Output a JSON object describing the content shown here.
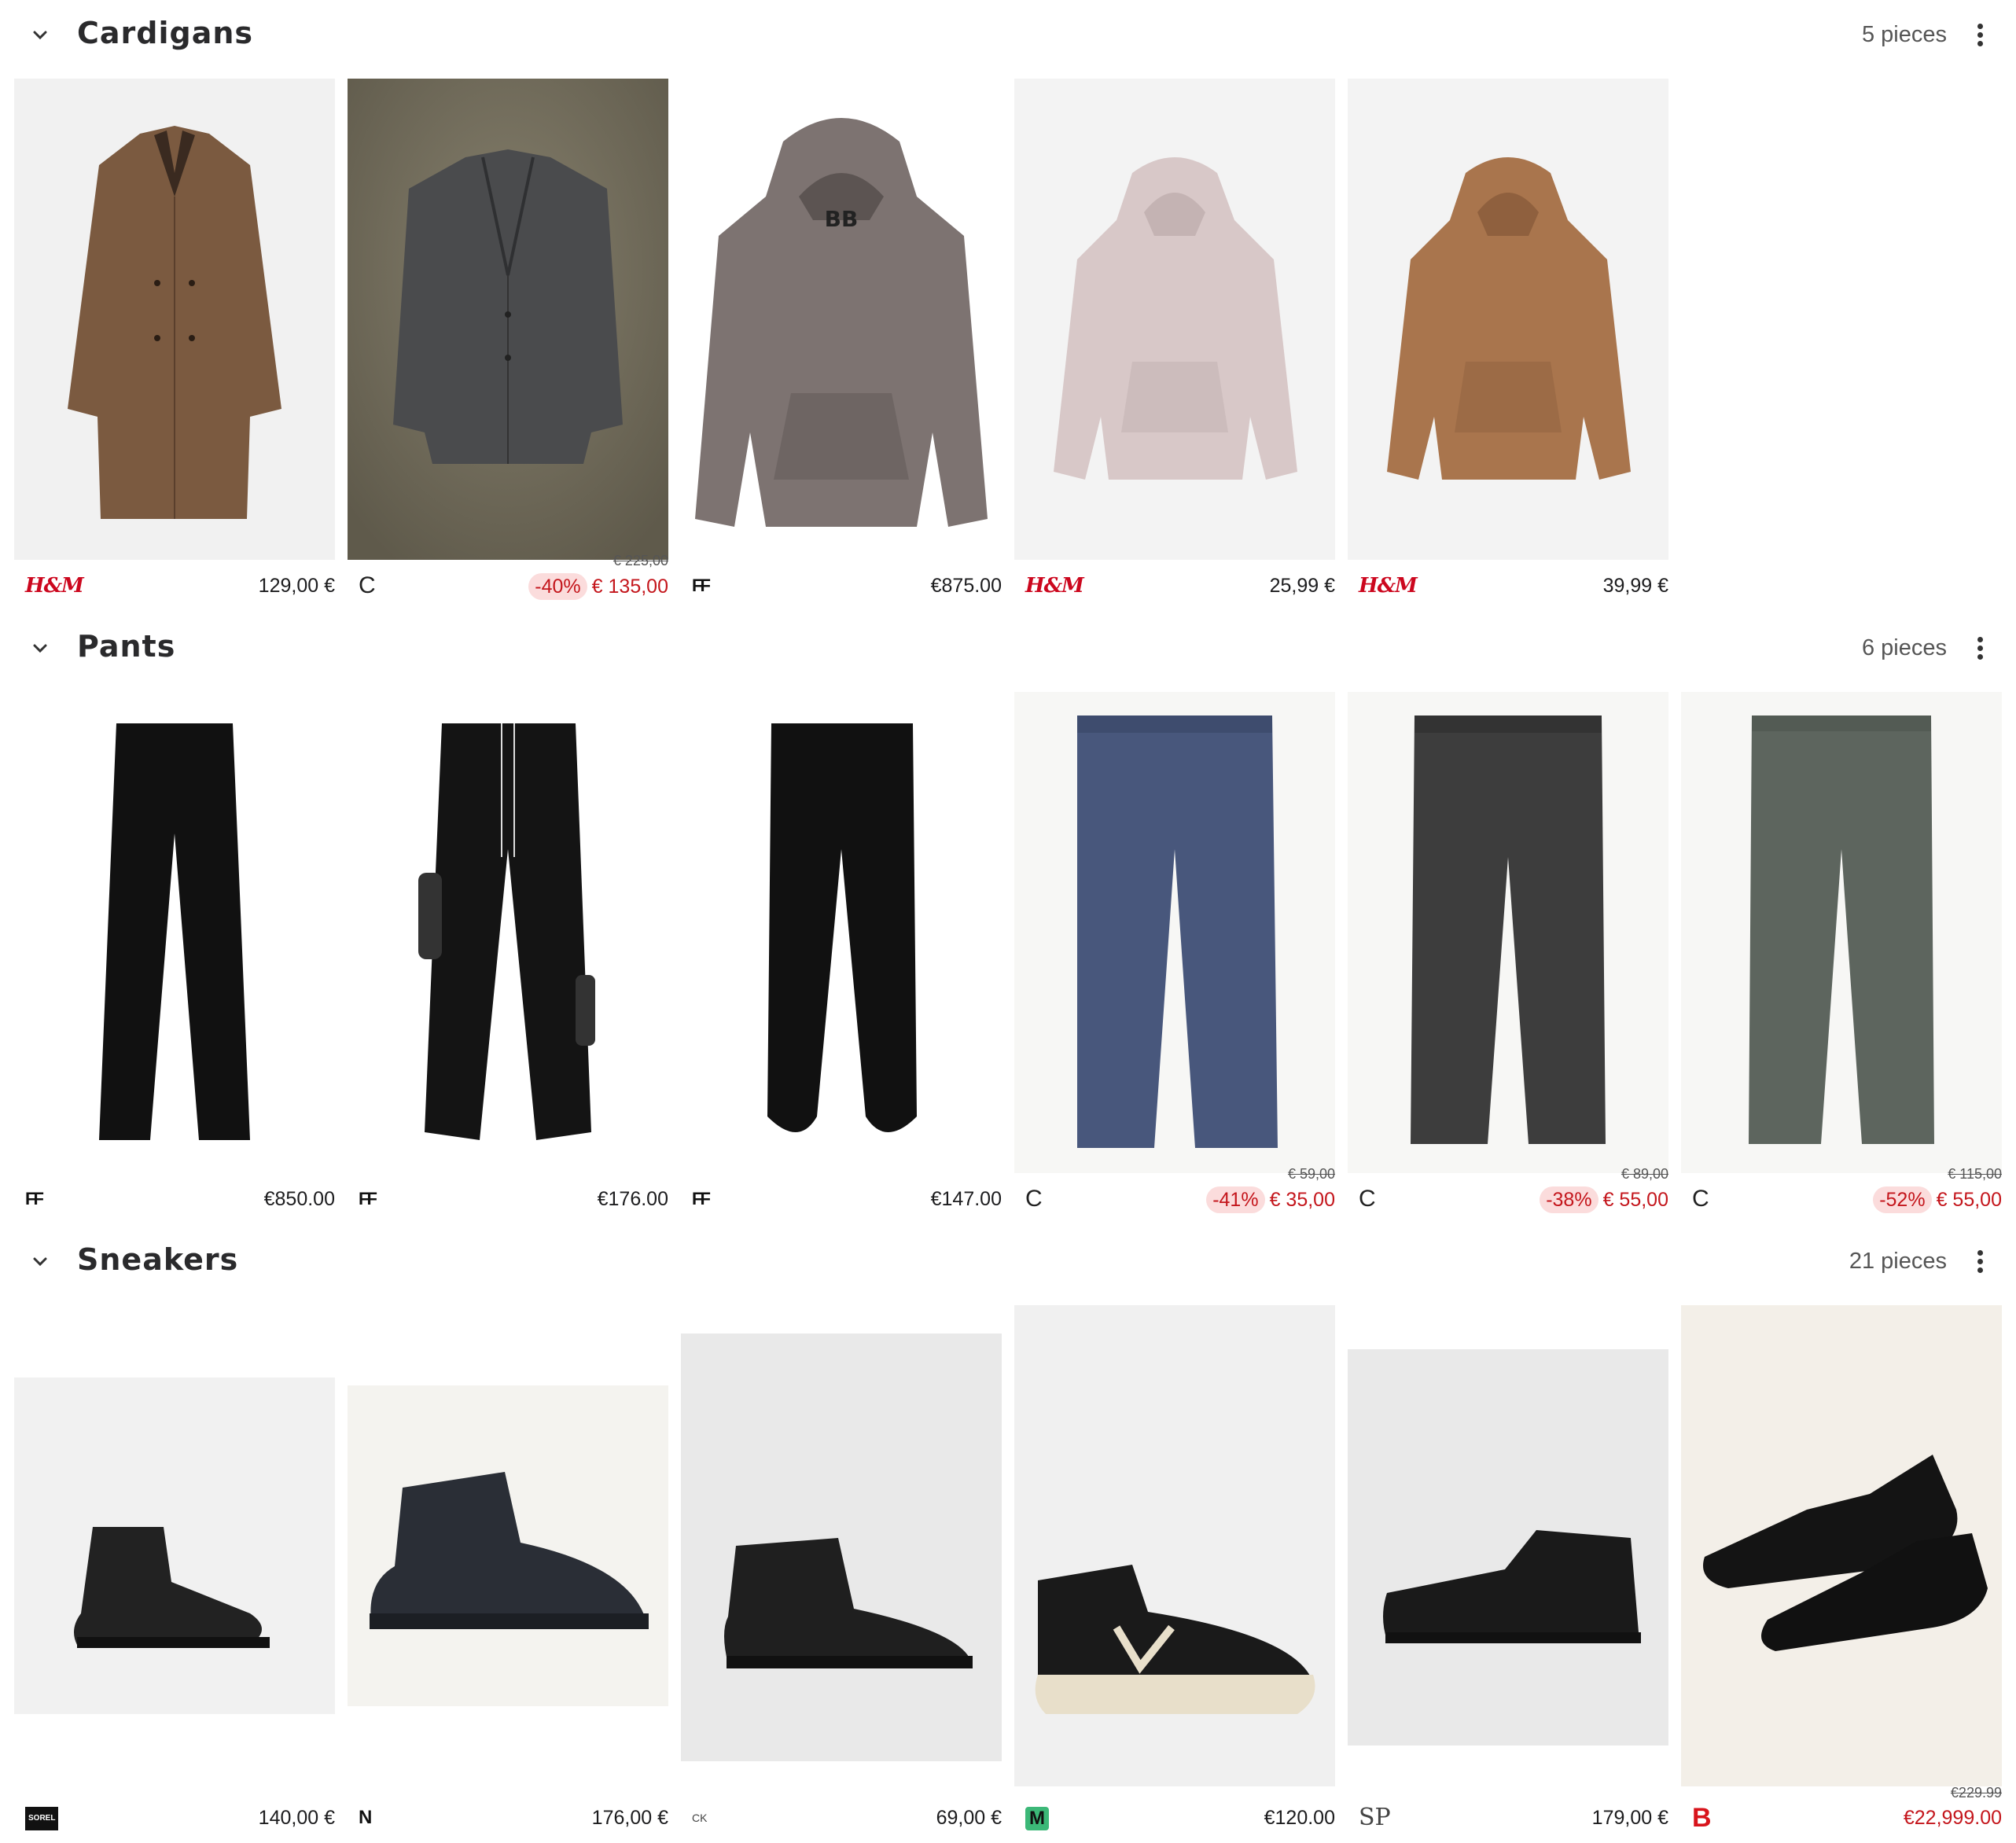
{
  "sections": [
    {
      "title": "Cardigans",
      "count": "5 pieces",
      "items": [
        {
          "image": "coat-brown",
          "brand": "H&M",
          "price": "129,00 €"
        },
        {
          "image": "blazer-grey",
          "brand": "C",
          "old_price": "€ 225,00",
          "discount": "-40%",
          "price": "€ 135,00"
        },
        {
          "image": "hoodie-taupe",
          "brand": "FF",
          "price": "€875.00"
        },
        {
          "image": "hoodie-pink",
          "brand": "H&M",
          "price": "25,99 €"
        },
        {
          "image": "hoodie-camel",
          "brand": "H&M",
          "price": "39,99 €"
        }
      ]
    },
    {
      "title": "Pants",
      "count": "6 pieces",
      "items": [
        {
          "image": "trousers-black",
          "brand": "FF",
          "price": "€850.00"
        },
        {
          "image": "cargo-black",
          "brand": "FF",
          "price": "€176.00"
        },
        {
          "image": "jogger-black",
          "brand": "FF",
          "price": "€147.00"
        },
        {
          "image": "trousers-navy",
          "brand": "C",
          "old_price": "€ 59,00",
          "discount": "-41%",
          "price": "€ 35,00"
        },
        {
          "image": "jeans-grey",
          "brand": "C",
          "old_price": "€ 89,00",
          "discount": "-38%",
          "price": "€ 55,00"
        },
        {
          "image": "trousers-green",
          "brand": "C",
          "old_price": "€ 115,00",
          "discount": "-52%",
          "price": "€ 55,00"
        }
      ]
    },
    {
      "title": "Sneakers",
      "count": "21 pieces",
      "items": [
        {
          "image": "boot-suede",
          "brand": "SOREL",
          "price": "140,00 €"
        },
        {
          "image": "boot-leather",
          "brand": "N",
          "price": "176,00 €"
        },
        {
          "image": "sneaker-canvas",
          "brand": "CK",
          "price": "69,00 €"
        },
        {
          "image": "sneaker-veja",
          "brand": "M",
          "price": "€120.00"
        },
        {
          "image": "sneaker-leather",
          "brand": "SP",
          "price": "179,00 €"
        },
        {
          "image": "sneaker-pair",
          "brand": "B",
          "old_price": "€229.99",
          "price": "€22,999.00"
        }
      ]
    }
  ],
  "colors": {
    "sale_red": "#c4161c",
    "discount_bg": "#fbdcdc",
    "title": "#2a2a2c"
  }
}
